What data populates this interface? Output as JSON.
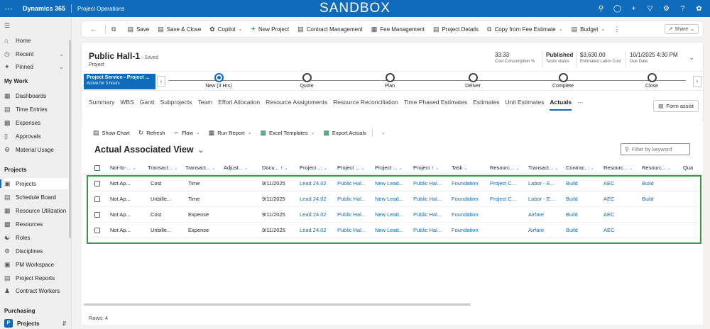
{
  "topbar": {
    "brand": "Dynamics 365",
    "app": "Project Operations",
    "banner": "SANDBOX",
    "icons": [
      "search-icon",
      "lightbulb-icon",
      "plus-icon",
      "filter-icon",
      "settings-icon",
      "help-icon",
      "copilot-icon"
    ]
  },
  "sidebar": {
    "top_items": [
      {
        "label": "Home",
        "icon": "home-icon"
      },
      {
        "label": "Recent",
        "icon": "clock-icon"
      },
      {
        "label": "Pinned",
        "icon": "pin-icon"
      }
    ],
    "groups": [
      {
        "heading": "My Work",
        "items": [
          "Dashboards",
          "Time Entries",
          "Expenses",
          "Approvals",
          "Material Usage"
        ]
      },
      {
        "heading": "Projects",
        "items": [
          "Projects",
          "Schedule Board",
          "Resource Utilization",
          "Resources",
          "Roles",
          "Disciplines",
          "PM Workspace",
          "Project Reports",
          "Contract Workers"
        ]
      },
      {
        "heading": "Purchasing",
        "items": []
      }
    ],
    "active": "Projects",
    "area": {
      "badge": "P",
      "label": "Projects"
    }
  },
  "cmdbar": {
    "items": [
      {
        "label": "Save",
        "icon": "save-icon"
      },
      {
        "label": "Save & Close",
        "icon": "save-close-icon"
      },
      {
        "label": "Copilot",
        "icon": "copilot-icon",
        "dropdown": true
      },
      {
        "label": "New Project",
        "icon": "plus-icon"
      },
      {
        "label": "Contract Management",
        "icon": "document-icon"
      },
      {
        "label": "Fee Management",
        "icon": "grid-icon"
      },
      {
        "label": "Project Details",
        "icon": "document-icon"
      },
      {
        "label": "Copy from Fee Estimate",
        "icon": "copy-icon",
        "dropdown": true
      },
      {
        "label": "Budget",
        "icon": "document-icon",
        "dropdown": true
      }
    ],
    "share": "Share"
  },
  "record": {
    "title": "Public Hall-1",
    "saved": "- Saved",
    "type": "Project",
    "stats": [
      {
        "value": "33.33",
        "label": "Cost Consumption %"
      },
      {
        "value": "Published",
        "label": "Tasks status"
      },
      {
        "value": "$3,630.00",
        "label": "Estimated Labor Cost"
      },
      {
        "value": "10/1/2025 4:30 PM",
        "label": "Due Date"
      }
    ]
  },
  "bpf": {
    "active_title": "Project Service - Project ...",
    "active_sub": "Active for 3 hours",
    "stages": [
      "New  (3 Hrs)",
      "Quote",
      "Plan",
      "Deliver",
      "Complete",
      "Close"
    ],
    "current_stage": 0
  },
  "tabs": {
    "items": [
      "Summary",
      "WBS",
      "Gantt",
      "Subprojects",
      "Team",
      "Effort Allocation",
      "Resource Assignments",
      "Resource Reconciliation",
      "Time Phased Estimates",
      "Estimates",
      "Unit Estimates",
      "Actuals",
      "···"
    ],
    "selected": "Actuals",
    "form_assist": "Form assist"
  },
  "grid": {
    "commands": [
      {
        "label": "Show Chart",
        "icon": "chart-icon"
      },
      {
        "label": "Refresh",
        "icon": "refresh-icon"
      },
      {
        "label": "Flow",
        "icon": "flow-icon",
        "dropdown": true
      },
      {
        "label": "Run Report",
        "icon": "report-icon",
        "dropdown": true
      },
      {
        "label": "Excel Templates",
        "icon": "excel-icon",
        "dropdown": true
      },
      {
        "label": "Export Actuals",
        "icon": "excel-icon"
      }
    ],
    "view_title": "Actual Associated View",
    "filter_placeholder": "Filter by keyword",
    "columns": [
      "Not-to-...",
      "Transact...",
      "Transact...",
      "Adjust...",
      "Docu... ↑",
      "Project ...",
      "Project ...",
      "Project ...",
      "Project ↑",
      "Task",
      "Resourc...",
      "Transact...",
      "Contrac...",
      "Resourc...",
      "Resourc...",
      "Qua"
    ],
    "rows": [
      [
        "Not Ap...",
        "Cost",
        "Time",
        "",
        "9/11/2025",
        "Lead 24.02",
        "Public Hal...",
        "New Lead...",
        "Public Hal...",
        "Foundation",
        "Project C...",
        "Labor - E...",
        "Build",
        "AEC",
        "Build",
        ""
      ],
      [
        "Not Ap...",
        "Unbille...",
        "Time",
        "",
        "9/11/2025",
        "Lead 24.02",
        "Public Hal...",
        "New Lead...",
        "Public Hal...",
        "Foundation",
        "Project C...",
        "Labor - E...",
        "Build",
        "AEC",
        "Build",
        ""
      ],
      [
        "Not Ap...",
        "Cost",
        "Expense",
        "",
        "9/11/2025",
        "Lead 24.02",
        "Public Hal...",
        "New Lead...",
        "Public Hal...",
        "Foundation",
        "",
        "Airfare",
        "Build",
        "AEC",
        "",
        ""
      ],
      [
        "Not Ap...",
        "Unbille...",
        "Expense",
        "",
        "9/11/2025",
        "Lead 24.02",
        "Public Hal...",
        "New Lead...",
        "Public Hal...",
        "Foundation",
        "",
        "Airfare",
        "Build",
        "AEC",
        "",
        ""
      ]
    ],
    "rows_label": "Rows: 4",
    "accent": "#0f6cbd",
    "highlight": "#2ea043"
  }
}
